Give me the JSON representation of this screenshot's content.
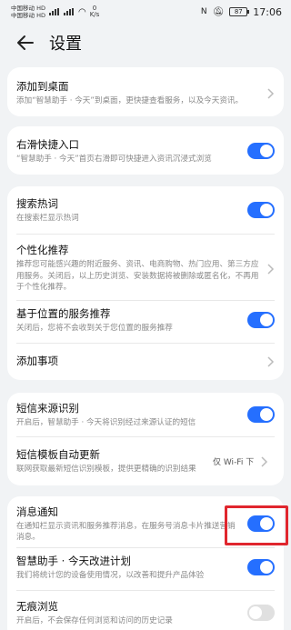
{
  "status_bar": {
    "carrier1": "中国移动",
    "carrier2": "中国移动",
    "net1": "HD",
    "net2": "HD",
    "speed": "0",
    "speed_unit": "K/s",
    "battery": "87",
    "time": "17:06"
  },
  "header": {
    "title": "设置"
  },
  "items": {
    "add_to_desktop": {
      "title": "添加到桌面",
      "sub": "添加“智慧助手 · 今天”到桌面，更快捷查看服务，以及今天资讯。"
    },
    "swipe_entry": {
      "title": "右滑快捷入口",
      "sub": "“智慧助手 · 今天”首页右滑即可快捷进入资讯沉浸式浏览",
      "on": true
    },
    "search_hot": {
      "title": "搜索热词",
      "sub": "在搜索栏显示热词",
      "on": true
    },
    "personalized": {
      "title": "个性化推荐",
      "sub": "推荐您可能感兴趣的附近服务、资讯、电商购物、热门应用、第三方应用服务。关闭后，以上历史浏览、安装数据将被删除或匿名化，不再用于个性化推荐。"
    },
    "location_service": {
      "title": "基于位置的服务推荐",
      "sub": "关闭后，您将不会收到关于您位置的服务推荐",
      "on": true
    },
    "add_items": {
      "title": "添加事项"
    },
    "sms_source": {
      "title": "短信来源识别",
      "sub": "开启后，智慧助手 · 今天将识别经过来源认证的短信",
      "on": true
    },
    "sms_template": {
      "title": "短信模板自动更新",
      "sub": "联网获取最新短信识别模板，提供更精确的识别结果",
      "value": "仅 Wi-Fi 下"
    },
    "notification": {
      "title": "消息通知",
      "sub": "在通知栏显示资讯和服务推荐消息，在服务号消息卡片推送营销消息。",
      "on": true
    },
    "improvement": {
      "title": "智慧助手 · 今天改进计划",
      "sub": "我们将统计您的设备使用情况，以改善和提升产品体验",
      "on": true
    },
    "incognito": {
      "title": "无痕浏览",
      "sub": "开启后，不会保存任何浏览和访问的历史记录",
      "on": false
    }
  },
  "colors": {
    "accent": "#256fff",
    "highlight": "#e0262e"
  }
}
